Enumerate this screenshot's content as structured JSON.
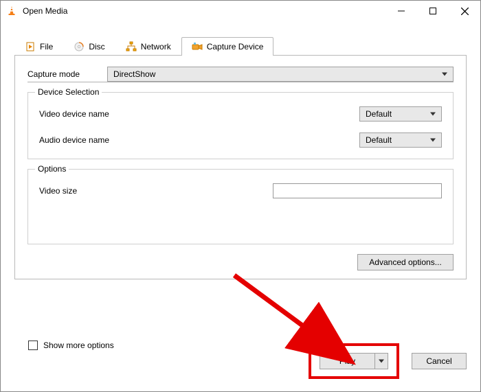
{
  "window": {
    "title": "Open Media"
  },
  "tabs": {
    "file": "File",
    "disc": "Disc",
    "network": "Network",
    "capture": "Capture Device"
  },
  "capture": {
    "mode_label": "Capture mode",
    "mode_value": "DirectShow",
    "device_selection_title": "Device Selection",
    "video_label": "Video device name",
    "video_value": "Default",
    "audio_label": "Audio device name",
    "audio_value": "Default",
    "options_title": "Options",
    "video_size_label": "Video size",
    "video_size_value": ""
  },
  "buttons": {
    "advanced": "Advanced options...",
    "play": "Play",
    "cancel": "Cancel"
  },
  "show_more": {
    "label": "Show more options",
    "checked": false
  }
}
